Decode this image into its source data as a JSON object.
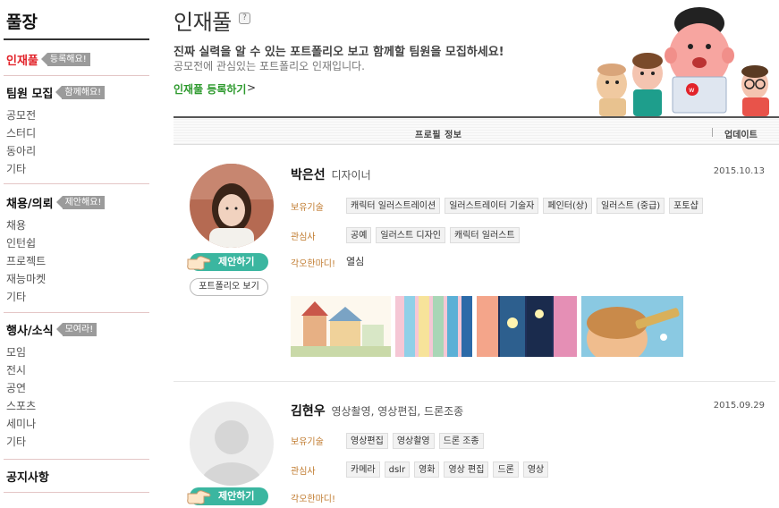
{
  "sidebar": {
    "title": "풀장",
    "featured": {
      "label": "인재풀",
      "tag": "등록해요!"
    },
    "sections": [
      {
        "label": "팀원 모집",
        "tag": "함께해요!",
        "items": [
          "공모전",
          "스터디",
          "동아리",
          "기타"
        ]
      },
      {
        "label": "채용/의뢰",
        "tag": "제안해요!",
        "items": [
          "채용",
          "인턴쉽",
          "프로젝트",
          "재능마켓",
          "기타"
        ]
      },
      {
        "label": "행사/소식",
        "tag": "모여라!",
        "items": [
          "모임",
          "전시",
          "공연",
          "스포츠",
          "세미나",
          "기타"
        ]
      }
    ],
    "notice": "공지사항"
  },
  "header": {
    "title": "인재풀",
    "help_icon": "?",
    "intro_main": "진짜 실력을 알 수 있는 포트폴리오 보고 함께할 팀원을 모집하세요!",
    "intro_sub": "공모전에 관심있는 포트폴리오 인재입니다.",
    "register_link": "인재풀 등록하기",
    "register_arrow": ">"
  },
  "list_header": {
    "info": "프로필 정보",
    "update": "업데이트"
  },
  "buttons": {
    "propose": "제안하기",
    "portfolio": "포트폴리오 보기"
  },
  "labels": {
    "skills": "보유기술",
    "interests": "관심사",
    "motto": "각오한마디!"
  },
  "profiles": [
    {
      "name": "박은선",
      "role": "디자이너",
      "date": "2015.10.13",
      "skills": [
        "캐릭터 일러스트레이션",
        "일러스트레이터 기술자",
        "페인터(상)",
        "일러스트 (중급)",
        "포토샵"
      ],
      "interests": [
        "공예",
        "일러스트 디자인",
        "캐릭터 일러스트"
      ],
      "motto": "열심"
    },
    {
      "name": "김현우",
      "role": "영상촬영, 영상편집, 드론조종",
      "date": "2015.09.29",
      "skills": [
        "영상편집",
        "영상촬영",
        "드론 조종"
      ],
      "interests": [
        "카메라",
        "dslr",
        "영화",
        "영상 편집",
        "드론",
        "영상"
      ],
      "motto": ""
    }
  ],
  "colors": {
    "accent_red": "#e2232a",
    "teal": "#3bb6a0",
    "link_green": "#2e9a2e",
    "label_orange": "#c07a2d"
  }
}
